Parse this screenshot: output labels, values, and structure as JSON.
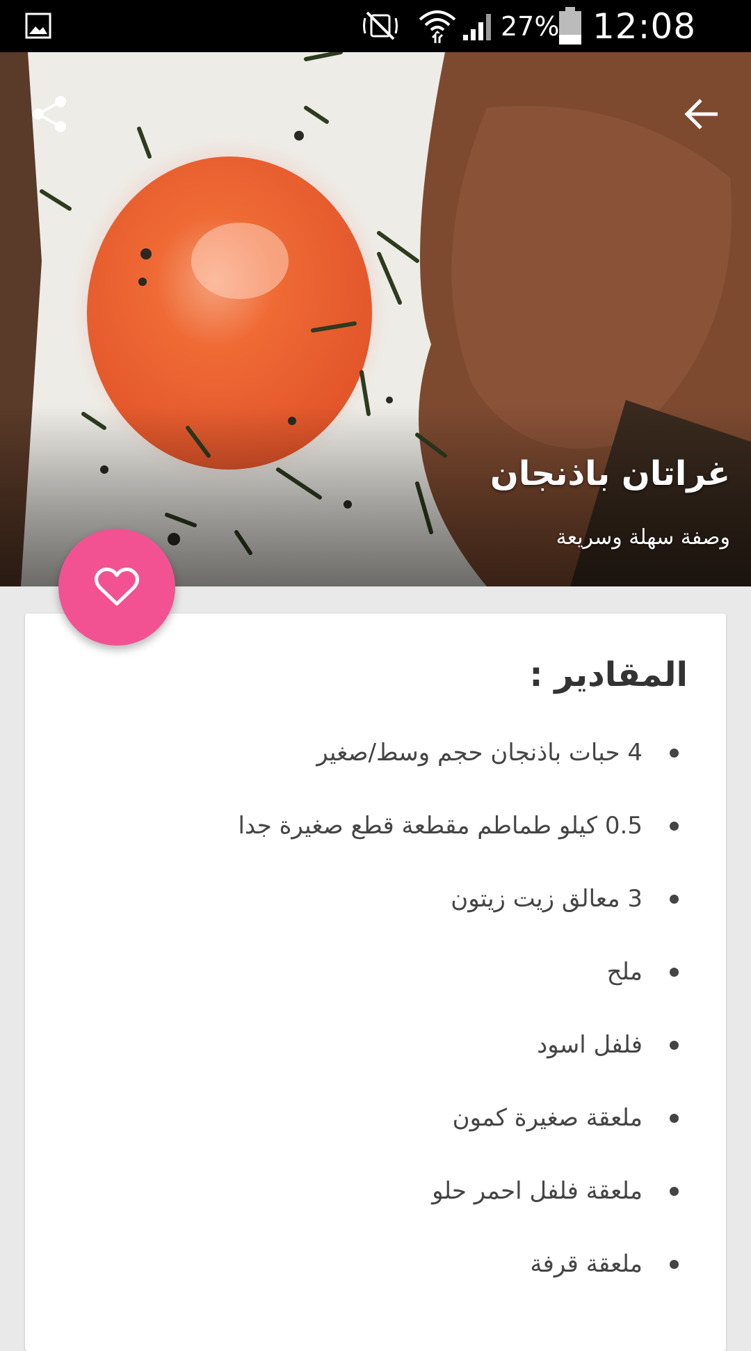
{
  "status_bar": {
    "battery_percent": "27%",
    "time": "12:08 AM",
    "icons": [
      "gallery-icon",
      "mute-icon",
      "wifi-icon",
      "signal-icon",
      "battery-icon"
    ]
  },
  "hero": {
    "title": "غراتان باذنجان",
    "subtitle": "وصفة سهلة وسريعة"
  },
  "toolbar": {
    "back_icon": "arrow-back-icon",
    "share_icon": "share-icon"
  },
  "fab": {
    "icon": "heart-outline-icon",
    "color": "#f25292"
  },
  "ingredients": {
    "title": "المقادير :",
    "items": [
      "4 حبات باذنجان حجم وسط/صغير",
      "0.5 كيلو طماطم مقطعة قطع صغيرة جدا",
      "3 معالق زيت زيتون",
      "ملح",
      "فلفل اسود",
      "ملعقة صغيرة كمون",
      "ملعقة فلفل احمر حلو",
      "ملعقة قرفة"
    ]
  }
}
